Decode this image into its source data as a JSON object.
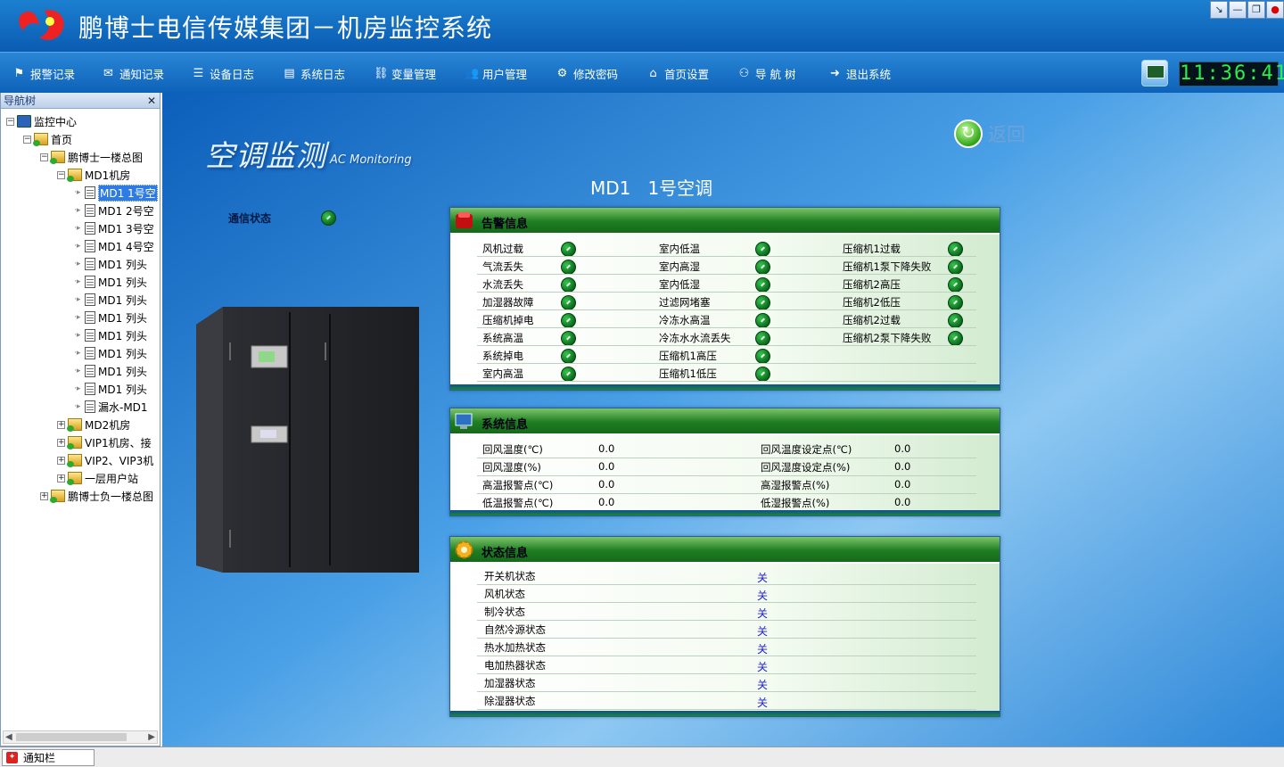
{
  "app": {
    "title": "鹏博士电信传媒集团－机房监控系统"
  },
  "toolbar": [
    {
      "label": "报警记录",
      "icon": "flag-icon"
    },
    {
      "label": "通知记录",
      "icon": "mail-icon"
    },
    {
      "label": "设备日志",
      "icon": "list-icon"
    },
    {
      "label": "系统日志",
      "icon": "log-icon"
    },
    {
      "label": "变量管理",
      "icon": "link-icon"
    },
    {
      "label": "用户管理",
      "icon": "users-icon"
    },
    {
      "label": "修改密码",
      "icon": "gear-icon"
    },
    {
      "label": "首页设置",
      "icon": "home-icon"
    },
    {
      "label": "导 航 树",
      "icon": "tree-icon"
    },
    {
      "label": "退出系统",
      "icon": "exit-icon"
    }
  ],
  "clock": "11:36:41",
  "sidebar": {
    "title": "导航树",
    "items": [
      {
        "label": "监控中心",
        "toggle": "−",
        "icon": "pc"
      },
      {
        "label": "首页",
        "toggle": "−",
        "icon": "fold"
      },
      {
        "label": "鹏博士一楼总图",
        "toggle": "−",
        "icon": "fold"
      },
      {
        "label": "MD1机房",
        "toggle": "−",
        "icon": "fold"
      },
      {
        "label": "MD1 1号空",
        "toggle": "",
        "icon": "doc"
      },
      {
        "label": "MD1 2号空",
        "toggle": "",
        "icon": "doc"
      },
      {
        "label": "MD1 3号空",
        "toggle": "",
        "icon": "doc"
      },
      {
        "label": "MD1 4号空",
        "toggle": "",
        "icon": "doc"
      },
      {
        "label": "MD1 列头",
        "toggle": "",
        "icon": "doc"
      },
      {
        "label": "MD1 列头",
        "toggle": "",
        "icon": "doc"
      },
      {
        "label": "MD1 列头",
        "toggle": "",
        "icon": "doc"
      },
      {
        "label": "MD1 列头",
        "toggle": "",
        "icon": "doc"
      },
      {
        "label": "MD1 列头",
        "toggle": "",
        "icon": "doc"
      },
      {
        "label": "MD1 列头",
        "toggle": "",
        "icon": "doc"
      },
      {
        "label": "MD1 列头",
        "toggle": "",
        "icon": "doc"
      },
      {
        "label": "MD1 列头",
        "toggle": "",
        "icon": "doc"
      },
      {
        "label": "漏水-MD1",
        "toggle": "",
        "icon": "doc"
      },
      {
        "label": "MD2机房",
        "toggle": "+",
        "icon": "fold"
      },
      {
        "label": "VIP1机房、接",
        "toggle": "+",
        "icon": "fold"
      },
      {
        "label": "VIP2、VIP3机",
        "toggle": "+",
        "icon": "fold"
      },
      {
        "label": "一层用户站",
        "toggle": "+",
        "icon": "fold"
      },
      {
        "label": "鹏博士负一楼总图",
        "toggle": "+",
        "icon": "fold"
      }
    ]
  },
  "main": {
    "heading_cn": "空调监测",
    "heading_en": "AC Monitoring",
    "back_label": "返回",
    "device_title": "MD1   1号空调",
    "comm_label": "通信状态",
    "alarm": {
      "title": "告警信息",
      "items": [
        "风机过载",
        "室内低温",
        "压缩机1过载",
        "气流丢失",
        "室内高湿",
        "压缩机1泵下降失败",
        "水流丢失",
        "室内低湿",
        "压缩机2高压",
        "加湿器故障",
        "过滤网堵塞",
        "压缩机2低压",
        "压缩机掉电",
        "冷冻水高温",
        "压缩机2过载",
        "系统高温",
        "冷冻水水流丢失",
        "压缩机2泵下降失败",
        "系统掉电",
        "压缩机1高压",
        "",
        "室内高温",
        "压缩机1低压",
        ""
      ]
    },
    "system": {
      "title": "系统信息",
      "rows": [
        {
          "l": "回风温度(℃)",
          "lv": "0.0",
          "r": "回风温度设定点(℃)",
          "rv": "0.0"
        },
        {
          "l": "回风湿度(%)",
          "lv": "0.0",
          "r": "回风湿度设定点(%)",
          "rv": "0.0"
        },
        {
          "l": "高温报警点(℃)",
          "lv": "0.0",
          "r": "高湿报警点(%)",
          "rv": "0.0"
        },
        {
          "l": "低温报警点(℃)",
          "lv": "0.0",
          "r": "低湿报警点(%)",
          "rv": "0.0"
        }
      ]
    },
    "state": {
      "title": "状态信息",
      "rows": [
        {
          "l": "开关机状态",
          "v": "关"
        },
        {
          "l": "风机状态",
          "v": "关"
        },
        {
          "l": "制冷状态",
          "v": "关"
        },
        {
          "l": "自然冷源状态",
          "v": "关"
        },
        {
          "l": "热水加热状态",
          "v": "关"
        },
        {
          "l": "电加热器状态",
          "v": "关"
        },
        {
          "l": "加湿器状态",
          "v": "关"
        },
        {
          "l": "除湿器状态",
          "v": "关"
        }
      ]
    }
  },
  "statusbar": {
    "tab": "通知栏"
  }
}
